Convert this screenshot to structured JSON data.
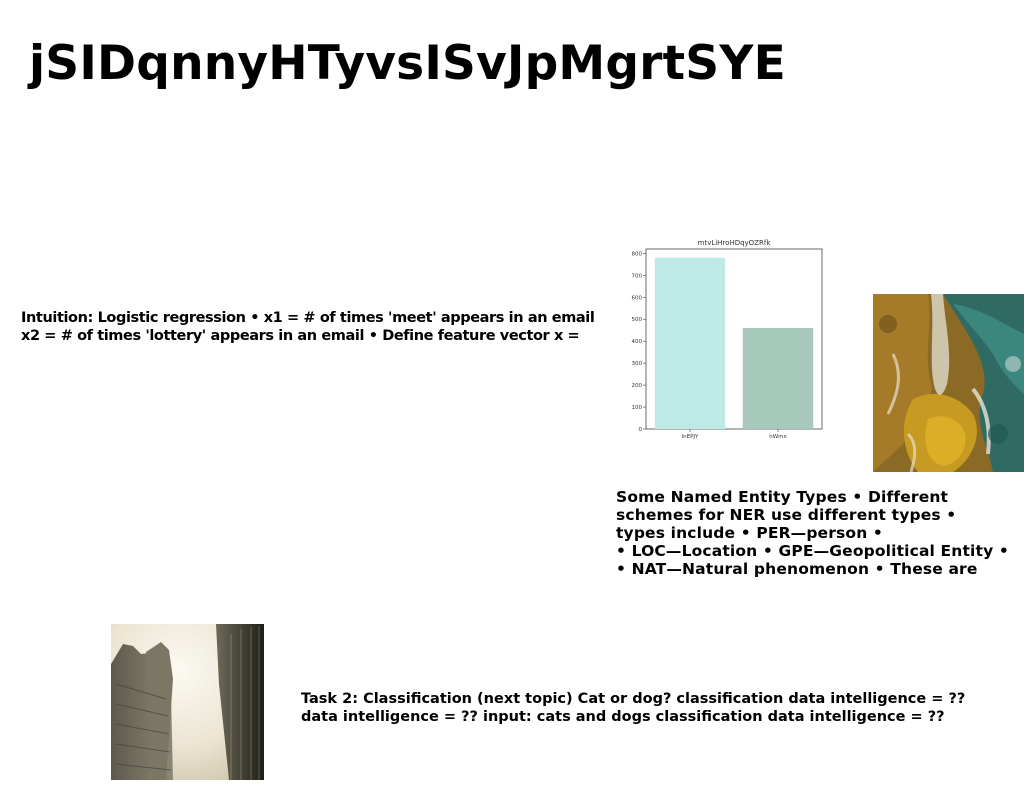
{
  "slide": {
    "title": "jSIDqnnyHTyvsISvJpMgrtSYE",
    "intuition_lines": [
      "Intuition: Logistic regression • x1 = # of times 'meet' appears in an email",
      "x2 = # of times 'lottery' appears in an email • Define feature vector x ="
    ],
    "ner_lines": [
      "Some Named Entity Types • Different",
      "schemes for NER use different types •",
      "types include • PER—person •",
      "• LOC—Location • GPE—Geopolitical Entity •",
      "• NAT—Natural phenomenon • These are"
    ],
    "task_lines": [
      "Task 2: Classification (next topic) Cat or dog? classification data intelligence = ??",
      "data intelligence = ?? input: cats and dogs classification data intelligence = ??"
    ]
  },
  "chart_data": {
    "type": "bar",
    "title": "mtvLiHroHDqyOZRfk",
    "categories": [
      "lnEPJY",
      "nWmx"
    ],
    "values": [
      780,
      460
    ],
    "colors": [
      "#bde9e6",
      "#a7c9bb"
    ],
    "ylim": [
      0,
      820
    ],
    "yticks": [
      0,
      100,
      200,
      300,
      400,
      500,
      600,
      700,
      800
    ],
    "xlabel": "",
    "ylabel": "",
    "grid": false
  },
  "images": {
    "satellite": "aerial-coastline-image",
    "city": "skyscrapers-photo"
  }
}
